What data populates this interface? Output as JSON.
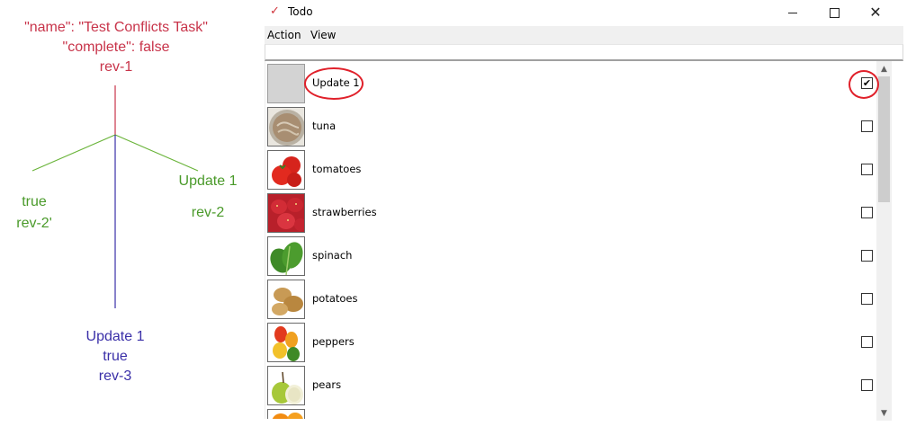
{
  "diagram": {
    "root": {
      "line1": "\"name\": \"Test Conflicts Task\"",
      "line2": "\"complete\": false",
      "line3": "rev-1"
    },
    "left_branch": {
      "line1": "true",
      "line2": "rev-2'"
    },
    "right_branch": {
      "line1": "Update 1",
      "line2": "rev-2"
    },
    "bottom_branch": {
      "line1": "Update 1",
      "line2": "true",
      "line3": "rev-3"
    },
    "colors": {
      "root": "#c8344a",
      "branch_green": "#4a9a2a",
      "branch_blue": "#3a2fa8"
    }
  },
  "window": {
    "title": "Todo",
    "app_icon": "checkmark-icon",
    "controls": {
      "minimize": "minimize-icon",
      "maximize": "maximize-icon",
      "close": "close-icon"
    },
    "menu": [
      "Action",
      "View"
    ]
  },
  "items": [
    {
      "label": "Update 1",
      "image": "blank",
      "checked": true
    },
    {
      "label": "tuna",
      "image": "tuna",
      "checked": false
    },
    {
      "label": "tomatoes",
      "image": "tomatoes",
      "checked": false
    },
    {
      "label": "strawberries",
      "image": "strawberries",
      "checked": false
    },
    {
      "label": "spinach",
      "image": "spinach",
      "checked": false
    },
    {
      "label": "potatoes",
      "image": "potatoes",
      "checked": false
    },
    {
      "label": "peppers",
      "image": "peppers",
      "checked": false
    },
    {
      "label": "pears",
      "image": "pears",
      "checked": false
    },
    {
      "label": "",
      "image": "oranges",
      "checked": false
    }
  ],
  "highlight_color": "#e0202a"
}
